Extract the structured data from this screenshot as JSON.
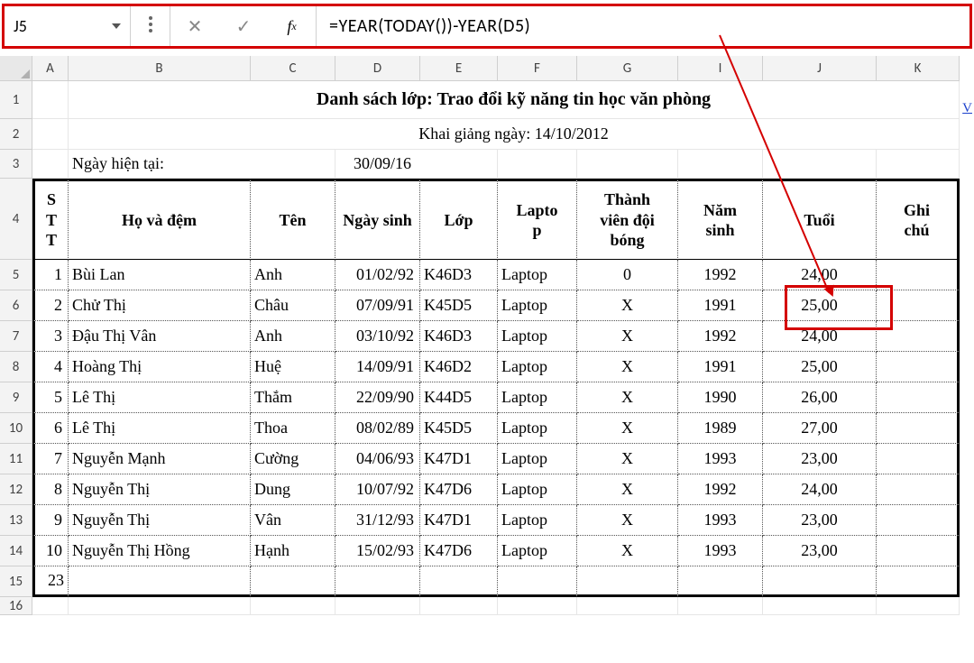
{
  "nameBox": "J5",
  "formula": "=YEAR(TODAY())-YEAR(D5)",
  "columns": [
    "A",
    "B",
    "C",
    "D",
    "E",
    "F",
    "G",
    "I",
    "J",
    "K"
  ],
  "rowHeaders": [
    1,
    2,
    3,
    4,
    5,
    6,
    7,
    8,
    9,
    10,
    11,
    12,
    13,
    14,
    15,
    16
  ],
  "title": "Danh sách lớp: Trao đổi kỹ năng tin học văn phòng",
  "subtitle": "Khai giảng ngày: 14/10/2012",
  "currentDateLabel": "Ngày hiện tại:",
  "currentDate": "30/09/16",
  "tableHeaders": {
    "stt": "S\nT\nT",
    "hodem": "Họ và đệm",
    "ten": "Tên",
    "ngaysinh": "Ngày sinh",
    "lop": "Lớp",
    "laptop": "Lapto\np",
    "thanhvien": "Thành\nviên đội\nbóng",
    "namsinh": "Năm\nsinh",
    "tuoi": "Tuổi",
    "ghichu": "Ghi\nchú"
  },
  "rows": [
    {
      "stt": "1",
      "hodem": "Bùi Lan",
      "ten": "Anh",
      "ngaysinh": "01/02/92",
      "lop": "K46D3",
      "laptop": "Laptop",
      "thanhvien": "0",
      "namsinh": "1992",
      "tuoi": "24,00",
      "ghichu": ""
    },
    {
      "stt": "2",
      "hodem": "Chử Thị",
      "ten": "Châu",
      "ngaysinh": "07/09/91",
      "lop": "K45D5",
      "laptop": "Laptop",
      "thanhvien": "X",
      "namsinh": "1991",
      "tuoi": "25,00",
      "ghichu": ""
    },
    {
      "stt": "3",
      "hodem": "Đậu Thị Vân",
      "ten": "Anh",
      "ngaysinh": "03/10/92",
      "lop": "K46D3",
      "laptop": "Laptop",
      "thanhvien": "X",
      "namsinh": "1992",
      "tuoi": "24,00",
      "ghichu": ""
    },
    {
      "stt": "4",
      "hodem": "Hoàng Thị",
      "ten": "Huệ",
      "ngaysinh": "14/09/91",
      "lop": "K46D2",
      "laptop": "Laptop",
      "thanhvien": "X",
      "namsinh": "1991",
      "tuoi": "25,00",
      "ghichu": ""
    },
    {
      "stt": "5",
      "hodem": "Lê Thị",
      "ten": "Thắm",
      "ngaysinh": "22/09/90",
      "lop": "K44D5",
      "laptop": "Laptop",
      "thanhvien": "X",
      "namsinh": "1990",
      "tuoi": "26,00",
      "ghichu": ""
    },
    {
      "stt": "6",
      "hodem": "Lê Thị",
      "ten": "Thoa",
      "ngaysinh": "08/02/89",
      "lop": "K45D5",
      "laptop": "Laptop",
      "thanhvien": "X",
      "namsinh": "1989",
      "tuoi": "27,00",
      "ghichu": ""
    },
    {
      "stt": "7",
      "hodem": "Nguyễn Mạnh",
      "ten": "Cường",
      "ngaysinh": "04/06/93",
      "lop": "K47D1",
      "laptop": "Laptop",
      "thanhvien": "X",
      "namsinh": "1993",
      "tuoi": "23,00",
      "ghichu": ""
    },
    {
      "stt": "8",
      "hodem": "Nguyễn Thị",
      "ten": "Dung",
      "ngaysinh": "10/07/92",
      "lop": "K47D6",
      "laptop": "Laptop",
      "thanhvien": "X",
      "namsinh": "1992",
      "tuoi": "24,00",
      "ghichu": ""
    },
    {
      "stt": "9",
      "hodem": "Nguyễn Thị",
      "ten": "Vân",
      "ngaysinh": "31/12/93",
      "lop": "K47D1",
      "laptop": "Laptop",
      "thanhvien": "X",
      "namsinh": "1993",
      "tuoi": "23,00",
      "ghichu": ""
    },
    {
      "stt": "10",
      "hodem": "Nguyễn Thị Hồng",
      "ten": "Hạnh",
      "ngaysinh": "15/02/93",
      "lop": "K47D6",
      "laptop": "Laptop",
      "thanhvien": "X",
      "namsinh": "1993",
      "tuoi": "23,00",
      "ghichu": ""
    }
  ],
  "row15A": "23",
  "cornerLink": "V"
}
